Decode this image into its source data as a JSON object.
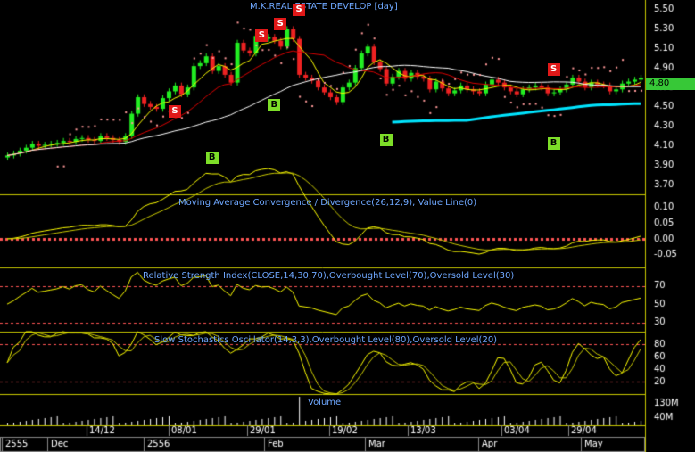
{
  "chart_data": [
    {
      "type": "candlestick",
      "title": "M.K.REAL ESTATE DEVELOP [day]",
      "ylim": [
        3.6,
        5.6
      ],
      "y_ticks": [
        "5.50",
        "5.30",
        "5.10",
        "4.90",
        "4.70",
        "4.50",
        "4.30",
        "4.10",
        "3.90",
        "3.70"
      ],
      "last_price_label": "4.80",
      "series": [
        {
          "name": "Close",
          "values": [
            4.0,
            4.02,
            4.05,
            4.08,
            4.12,
            4.1,
            4.11,
            4.12,
            4.13,
            4.15,
            4.14,
            4.17,
            4.18,
            4.16,
            4.15,
            4.2,
            4.18,
            4.16,
            4.14,
            4.2,
            4.43,
            4.6,
            4.53,
            4.5,
            4.48,
            4.59,
            4.66,
            4.72,
            4.63,
            4.7,
            4.92,
            4.95,
            5.02,
            4.87,
            4.92,
            4.83,
            4.75,
            5.16,
            5.08,
            5.05,
            5.23,
            5.2,
            5.22,
            5.18,
            5.12,
            5.3,
            5.2,
            4.83,
            4.8,
            4.77,
            4.7,
            4.65,
            4.6,
            4.55,
            4.7,
            4.75,
            4.9,
            5.05,
            5.12,
            4.96,
            4.89,
            4.74,
            4.81,
            4.87,
            4.79,
            4.85,
            4.81,
            4.79,
            4.68,
            4.76,
            4.69,
            4.64,
            4.67,
            4.72,
            4.68,
            4.66,
            4.64,
            4.73,
            4.78,
            4.75,
            4.7,
            4.66,
            4.63,
            4.68,
            4.7,
            4.72,
            4.7,
            4.64,
            4.65,
            4.68,
            4.73,
            4.8,
            4.76,
            4.7,
            4.75,
            4.73,
            4.72,
            4.66,
            4.68,
            4.74,
            4.76,
            4.78,
            4.8
          ]
        }
      ],
      "signals": [
        {
          "label": "S",
          "value": 4.45
        },
        {
          "label": "S",
          "value": 5.23
        },
        {
          "label": "S",
          "value": 5.35
        },
        {
          "label": "S",
          "value": 5.5
        },
        {
          "label": "S",
          "value": 4.88
        },
        {
          "label": "B",
          "value": 4.52
        },
        {
          "label": "B",
          "value": 3.98
        },
        {
          "label": "B",
          "value": 4.16
        },
        {
          "label": "B",
          "value": 4.12
        }
      ]
    },
    {
      "type": "line",
      "title": "Moving Average Convergence / Divergence(26,12,9), Value Line(0)",
      "y_ticks": [
        "0.10",
        "0.05",
        "0.00",
        "-0.05"
      ]
    },
    {
      "type": "line",
      "title": "Relative Strength Index(CLOSE,14,30,70),Overbought Level(70),Oversold Level(30)",
      "y_ticks": [
        "70",
        "50",
        "30"
      ],
      "ylim": [
        20,
        90
      ]
    },
    {
      "type": "line",
      "title": "Slow Stochastics Oscillator(14,3,3),Overbought Level(80),Oversold Level(20)",
      "y_ticks": [
        "80",
        "60",
        "40",
        "20"
      ],
      "ylim": [
        0,
        100
      ]
    },
    {
      "type": "bar",
      "title": "Volume",
      "y_ticks": [
        "130M",
        "40M"
      ]
    }
  ],
  "x_axis": {
    "date_ticks": [
      "14/12",
      "08/01",
      "29/01",
      "19/02",
      "13/03",
      "03/04",
      "29/04"
    ],
    "period_labels": [
      "2555",
      "Dec",
      "2556",
      "Feb",
      "Mar",
      "Apr",
      "May"
    ]
  },
  "colors": {
    "up": "#22ee22",
    "down": "#ee2222",
    "ma_fast": "#ffff00",
    "ma_mid": "#dd0000",
    "ma_slow": "#ffffff",
    "ma_long": "#00e5ff",
    "sar": "#ff9999",
    "signal": "#ffff00",
    "macd": "#ffff00",
    "level": "#ff5555",
    "panel_border": "#c8c800",
    "title": "#6fa8ff",
    "tick": "#ffffff"
  }
}
